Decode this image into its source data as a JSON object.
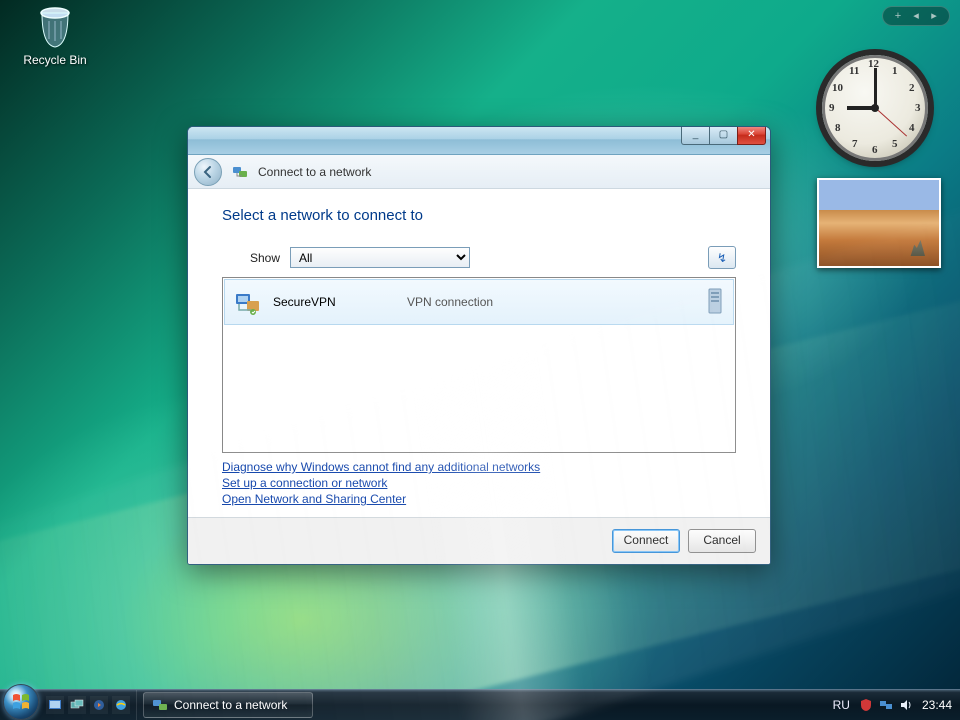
{
  "desktop": {
    "recycle_bin_label": "Recycle Bin"
  },
  "clock": {
    "hour": 9,
    "minute": 0,
    "second": 22,
    "numerals": [
      "12",
      "1",
      "2",
      "3",
      "4",
      "5",
      "6",
      "7",
      "8",
      "9",
      "10",
      "11"
    ]
  },
  "dialog": {
    "title": "Connect to a network",
    "heading": "Select a network to connect to",
    "show_label": "Show",
    "show_value": "All",
    "networks": [
      {
        "name": "SecureVPN",
        "type": "VPN connection"
      }
    ],
    "links": {
      "diagnose": "Diagnose why Windows cannot find any additional networks",
      "setup": "Set up a connection or network",
      "center": "Open Network and Sharing Center"
    },
    "buttons": {
      "connect": "Connect",
      "cancel": "Cancel"
    }
  },
  "taskbar": {
    "task_label": "Connect to a network",
    "lang": "RU",
    "time": "23:44"
  }
}
